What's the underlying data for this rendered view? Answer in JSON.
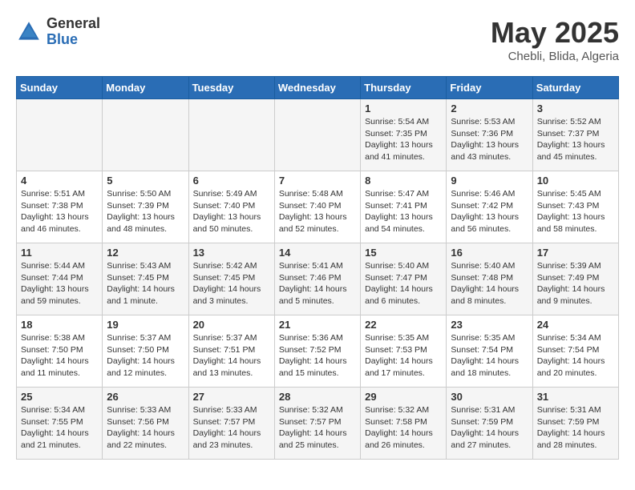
{
  "logo": {
    "general": "General",
    "blue": "Blue"
  },
  "header": {
    "month": "May 2025",
    "location": "Chebli, Blida, Algeria"
  },
  "days_of_week": [
    "Sunday",
    "Monday",
    "Tuesday",
    "Wednesday",
    "Thursday",
    "Friday",
    "Saturday"
  ],
  "weeks": [
    [
      {
        "day": "",
        "info": ""
      },
      {
        "day": "",
        "info": ""
      },
      {
        "day": "",
        "info": ""
      },
      {
        "day": "",
        "info": ""
      },
      {
        "day": "1",
        "info": "Sunrise: 5:54 AM\nSunset: 7:35 PM\nDaylight: 13 hours\nand 41 minutes."
      },
      {
        "day": "2",
        "info": "Sunrise: 5:53 AM\nSunset: 7:36 PM\nDaylight: 13 hours\nand 43 minutes."
      },
      {
        "day": "3",
        "info": "Sunrise: 5:52 AM\nSunset: 7:37 PM\nDaylight: 13 hours\nand 45 minutes."
      }
    ],
    [
      {
        "day": "4",
        "info": "Sunrise: 5:51 AM\nSunset: 7:38 PM\nDaylight: 13 hours\nand 46 minutes."
      },
      {
        "day": "5",
        "info": "Sunrise: 5:50 AM\nSunset: 7:39 PM\nDaylight: 13 hours\nand 48 minutes."
      },
      {
        "day": "6",
        "info": "Sunrise: 5:49 AM\nSunset: 7:40 PM\nDaylight: 13 hours\nand 50 minutes."
      },
      {
        "day": "7",
        "info": "Sunrise: 5:48 AM\nSunset: 7:40 PM\nDaylight: 13 hours\nand 52 minutes."
      },
      {
        "day": "8",
        "info": "Sunrise: 5:47 AM\nSunset: 7:41 PM\nDaylight: 13 hours\nand 54 minutes."
      },
      {
        "day": "9",
        "info": "Sunrise: 5:46 AM\nSunset: 7:42 PM\nDaylight: 13 hours\nand 56 minutes."
      },
      {
        "day": "10",
        "info": "Sunrise: 5:45 AM\nSunset: 7:43 PM\nDaylight: 13 hours\nand 58 minutes."
      }
    ],
    [
      {
        "day": "11",
        "info": "Sunrise: 5:44 AM\nSunset: 7:44 PM\nDaylight: 13 hours\nand 59 minutes."
      },
      {
        "day": "12",
        "info": "Sunrise: 5:43 AM\nSunset: 7:45 PM\nDaylight: 14 hours\nand 1 minute."
      },
      {
        "day": "13",
        "info": "Sunrise: 5:42 AM\nSunset: 7:45 PM\nDaylight: 14 hours\nand 3 minutes."
      },
      {
        "day": "14",
        "info": "Sunrise: 5:41 AM\nSunset: 7:46 PM\nDaylight: 14 hours\nand 5 minutes."
      },
      {
        "day": "15",
        "info": "Sunrise: 5:40 AM\nSunset: 7:47 PM\nDaylight: 14 hours\nand 6 minutes."
      },
      {
        "day": "16",
        "info": "Sunrise: 5:40 AM\nSunset: 7:48 PM\nDaylight: 14 hours\nand 8 minutes."
      },
      {
        "day": "17",
        "info": "Sunrise: 5:39 AM\nSunset: 7:49 PM\nDaylight: 14 hours\nand 9 minutes."
      }
    ],
    [
      {
        "day": "18",
        "info": "Sunrise: 5:38 AM\nSunset: 7:50 PM\nDaylight: 14 hours\nand 11 minutes."
      },
      {
        "day": "19",
        "info": "Sunrise: 5:37 AM\nSunset: 7:50 PM\nDaylight: 14 hours\nand 12 minutes."
      },
      {
        "day": "20",
        "info": "Sunrise: 5:37 AM\nSunset: 7:51 PM\nDaylight: 14 hours\nand 13 minutes."
      },
      {
        "day": "21",
        "info": "Sunrise: 5:36 AM\nSunset: 7:52 PM\nDaylight: 14 hours\nand 15 minutes."
      },
      {
        "day": "22",
        "info": "Sunrise: 5:35 AM\nSunset: 7:53 PM\nDaylight: 14 hours\nand 17 minutes."
      },
      {
        "day": "23",
        "info": "Sunrise: 5:35 AM\nSunset: 7:54 PM\nDaylight: 14 hours\nand 18 minutes."
      },
      {
        "day": "24",
        "info": "Sunrise: 5:34 AM\nSunset: 7:54 PM\nDaylight: 14 hours\nand 20 minutes."
      }
    ],
    [
      {
        "day": "25",
        "info": "Sunrise: 5:34 AM\nSunset: 7:55 PM\nDaylight: 14 hours\nand 21 minutes."
      },
      {
        "day": "26",
        "info": "Sunrise: 5:33 AM\nSunset: 7:56 PM\nDaylight: 14 hours\nand 22 minutes."
      },
      {
        "day": "27",
        "info": "Sunrise: 5:33 AM\nSunset: 7:57 PM\nDaylight: 14 hours\nand 23 minutes."
      },
      {
        "day": "28",
        "info": "Sunrise: 5:32 AM\nSunset: 7:57 PM\nDaylight: 14 hours\nand 25 minutes."
      },
      {
        "day": "29",
        "info": "Sunrise: 5:32 AM\nSunset: 7:58 PM\nDaylight: 14 hours\nand 26 minutes."
      },
      {
        "day": "30",
        "info": "Sunrise: 5:31 AM\nSunset: 7:59 PM\nDaylight: 14 hours\nand 27 minutes."
      },
      {
        "day": "31",
        "info": "Sunrise: 5:31 AM\nSunset: 7:59 PM\nDaylight: 14 hours\nand 28 minutes."
      }
    ]
  ]
}
